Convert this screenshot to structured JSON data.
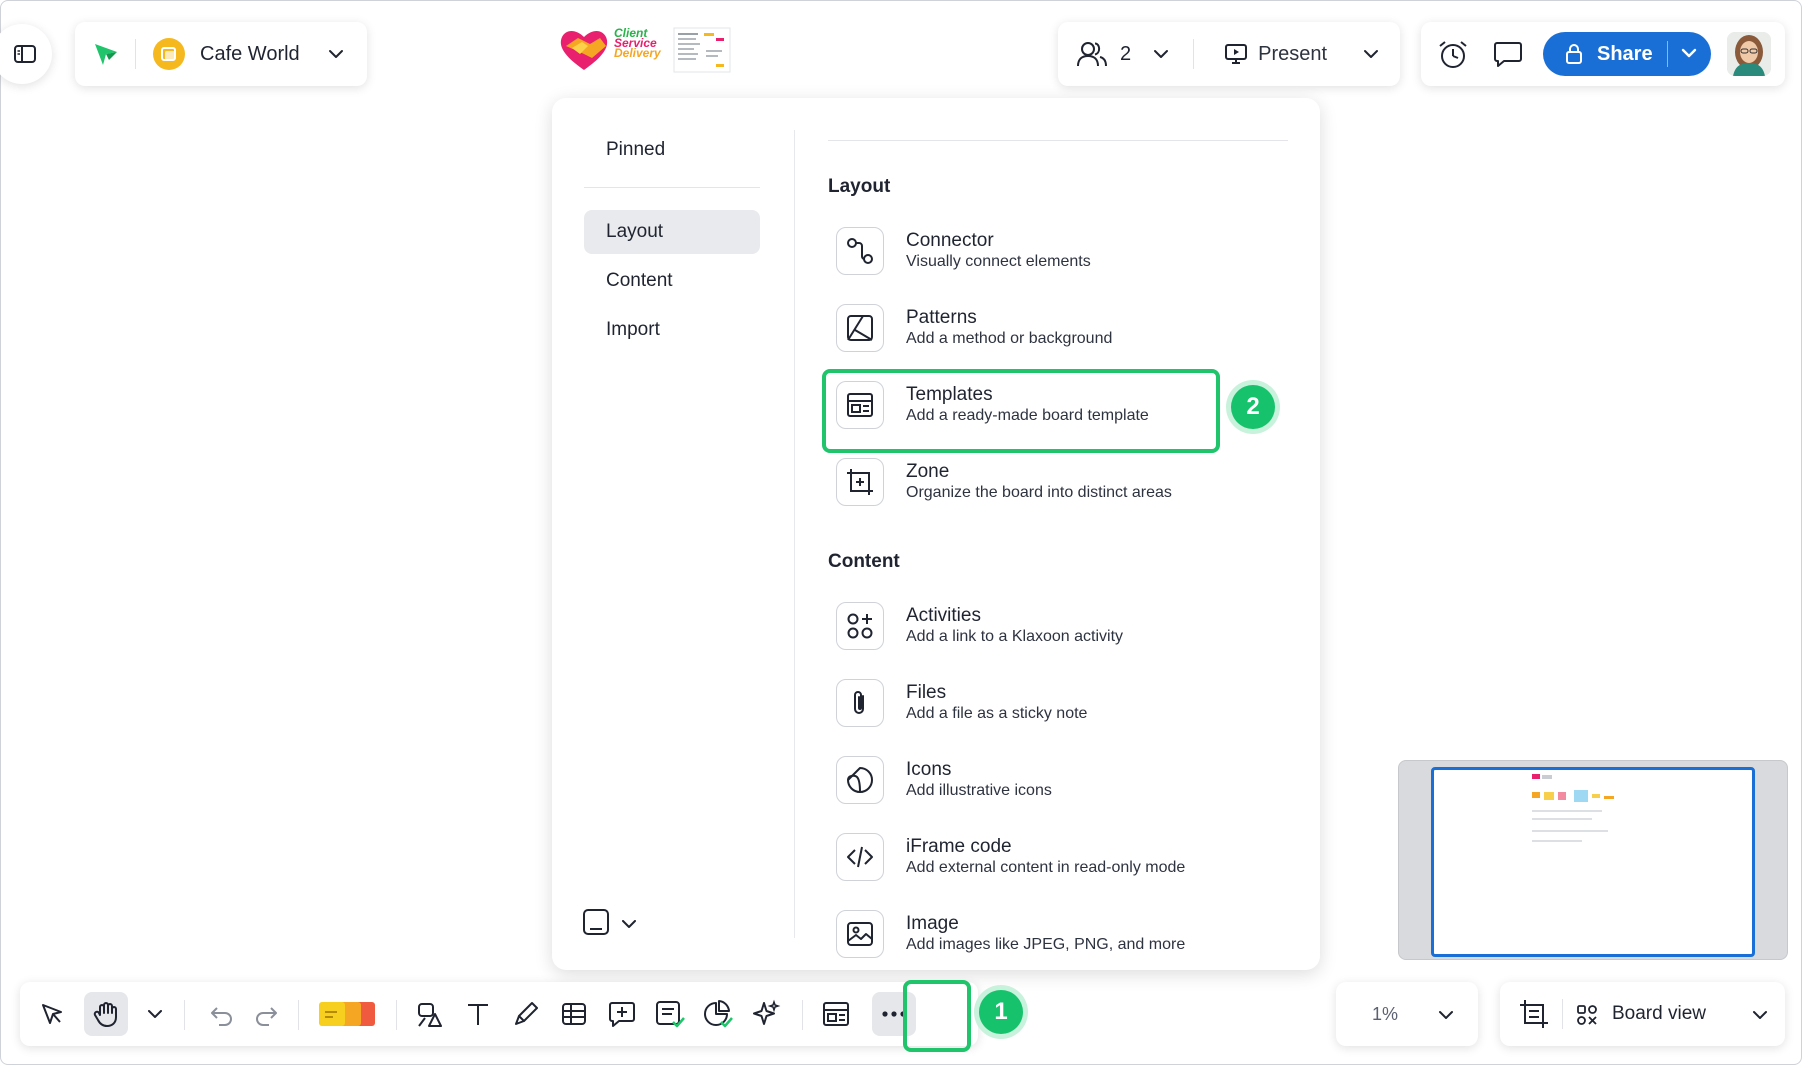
{
  "app": {
    "board_name": "Cafe World",
    "logo_text": [
      "Client",
      "Service",
      "Delivery"
    ]
  },
  "header": {
    "participants_count": "2",
    "present_label": "Present",
    "share_label": "Share"
  },
  "menu": {
    "left_items": [
      {
        "label": "Pinned"
      },
      {
        "label": "Layout",
        "active": true
      },
      {
        "label": "Content"
      },
      {
        "label": "Import"
      }
    ],
    "sections": [
      {
        "title": "Layout",
        "items": [
          {
            "title": "Connector",
            "desc": "Visually connect elements",
            "icon": "connector-icon"
          },
          {
            "title": "Patterns",
            "desc": "Add a method or background",
            "icon": "patterns-icon"
          },
          {
            "title": "Templates",
            "desc": "Add a ready-made board template",
            "icon": "templates-icon",
            "highlighted": true
          },
          {
            "title": "Zone",
            "desc": "Organize the board into distinct areas",
            "icon": "zone-icon"
          }
        ]
      },
      {
        "title": "Content",
        "items": [
          {
            "title": "Activities",
            "desc": "Add a link to a Klaxoon activity",
            "icon": "activities-icon"
          },
          {
            "title": "Files",
            "desc": "Add a file as a sticky note",
            "icon": "paperclip-icon"
          },
          {
            "title": "Icons",
            "desc": "Add illustrative icons",
            "icon": "sticker-icon"
          },
          {
            "title": "iFrame code",
            "desc": "Add external content in read-only mode",
            "icon": "code-icon"
          },
          {
            "title": "Image",
            "desc": "Add images like JPEG, PNG, and more",
            "icon": "image-icon"
          }
        ]
      }
    ]
  },
  "steps": {
    "step1": "1",
    "step2": "2"
  },
  "bottom": {
    "zoom": "1%",
    "board_view_label": "Board view"
  },
  "colors": {
    "accent_blue": "#1a6fd6",
    "highlight_green": "#1fc46b",
    "badge_green": "#16c26b"
  }
}
